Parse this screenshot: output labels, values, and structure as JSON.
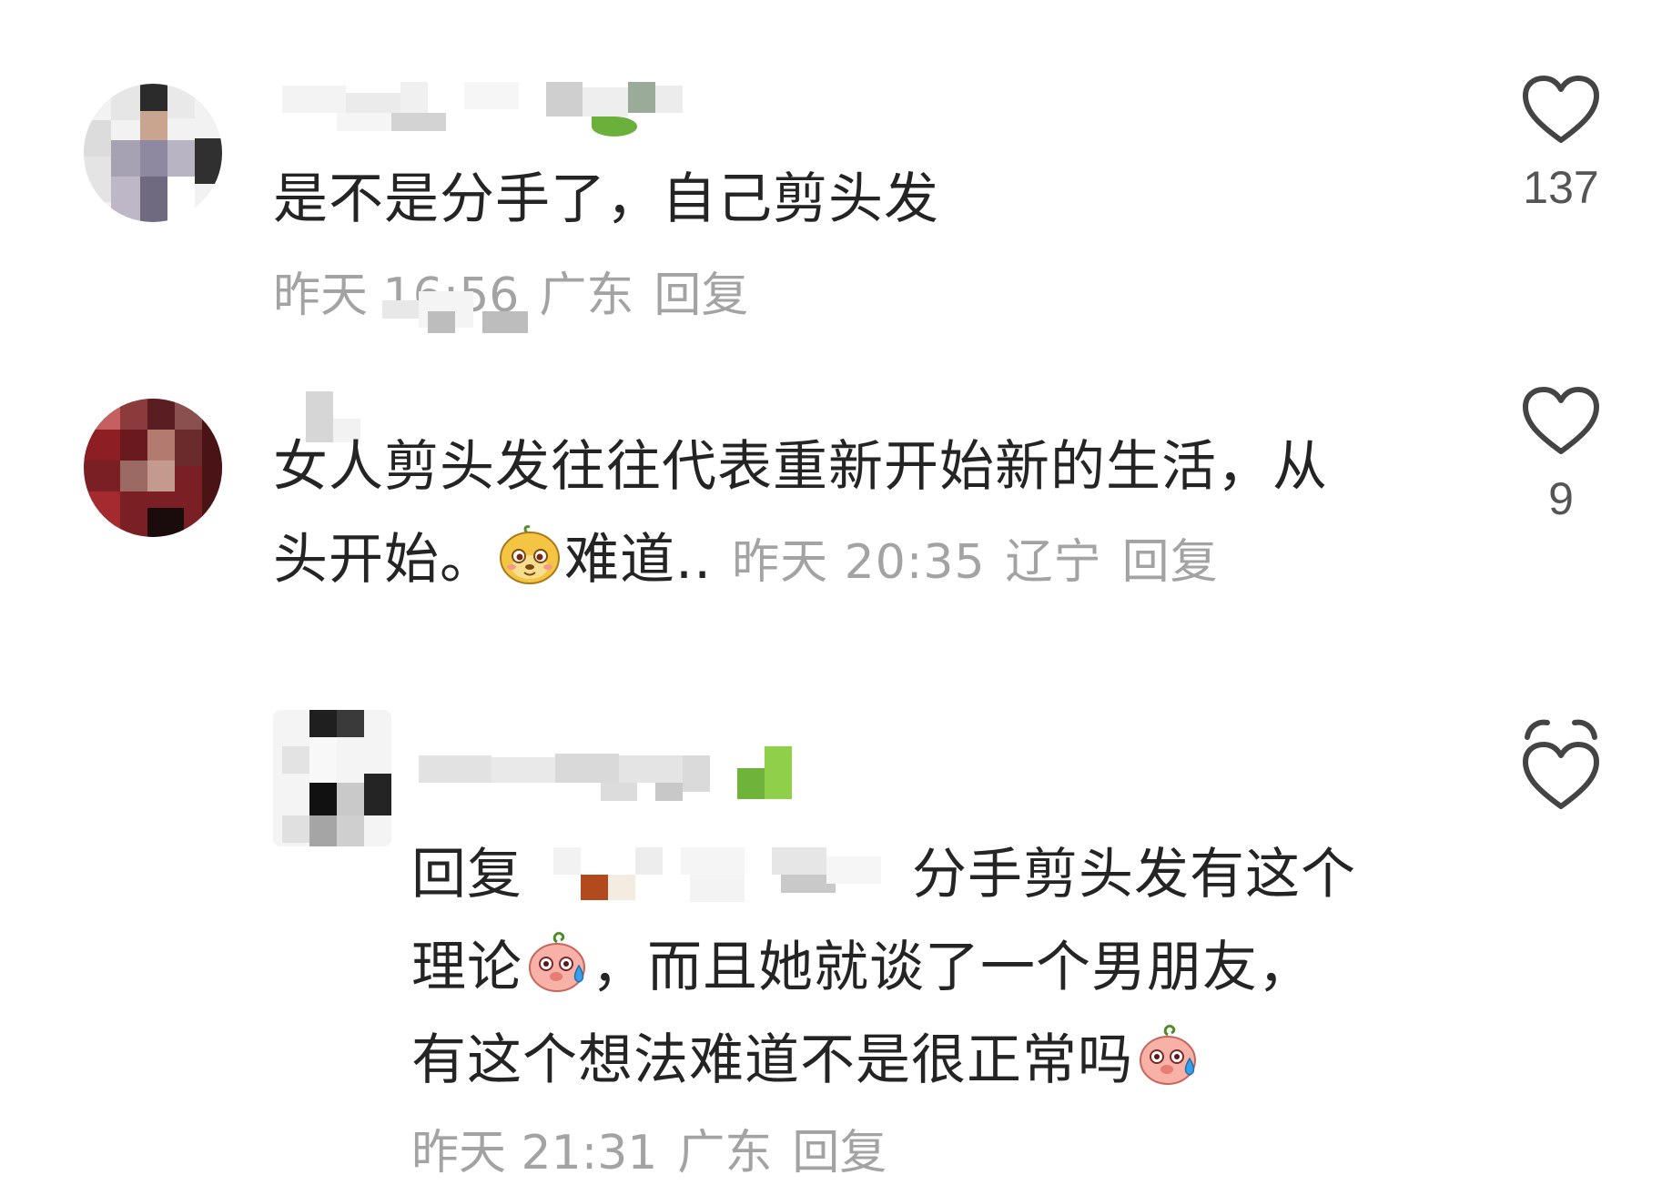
{
  "comments": [
    {
      "text": "是不是分手了，自己剪头发",
      "time": "昨天 16:56",
      "location": "广东",
      "reply_label": "回复",
      "likes": "137"
    },
    {
      "text_line1": "女人剪头发往往代表重新开始新的生活，从",
      "text_line2_start": "头开始。",
      "text_line2_end": "难道..",
      "emoji": "monkey-face-emoji",
      "time": "昨天 20:35",
      "location": "辽宁",
      "reply_label": "回复",
      "likes": "9"
    }
  ],
  "reply": {
    "reply_prefix": "回复",
    "text_line1_end": "分手剪头发有这个",
    "text_line2_start": "理论",
    "text_line2_end": "，而且她就谈了一个男朋友，",
    "text_line3": "有这个想法难道不是很正常吗",
    "emoji": "sweating-pig-face-emoji",
    "time": "昨天 21:31",
    "location": "广东",
    "reply_label": "回复"
  },
  "icons": {
    "like": "heart-outline-icon"
  },
  "colors": {
    "text": "#242424",
    "meta": "#a3a3a3",
    "heart": "#444444"
  }
}
